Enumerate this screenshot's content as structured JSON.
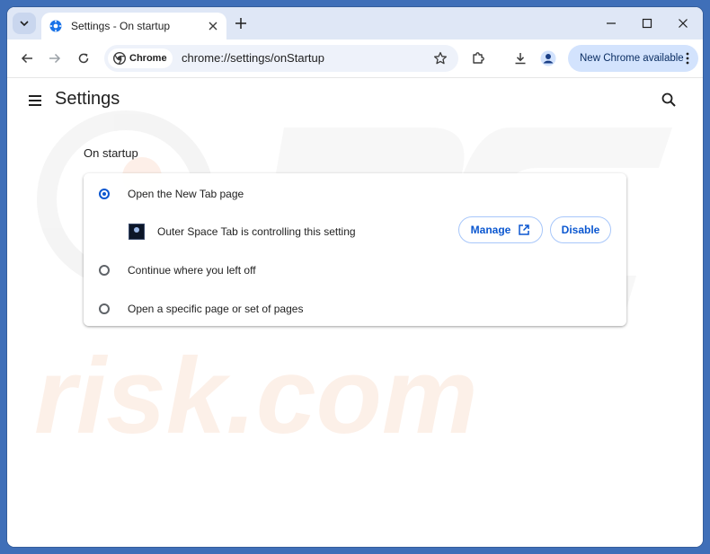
{
  "browser": {
    "tab_title": "Settings - On startup",
    "chip_label": "Chrome",
    "url": "chrome://settings/onStartup",
    "update_label": "New Chrome available"
  },
  "settings": {
    "page_title": "Settings",
    "section_title": "On startup",
    "options": [
      {
        "label": "Open the New Tab page",
        "selected": true
      },
      {
        "label": "Continue where you left off",
        "selected": false
      },
      {
        "label": "Open a specific page or set of pages",
        "selected": false
      }
    ],
    "extension": {
      "text": "Outer Space Tab is controlling this setting",
      "manage_label": "Manage",
      "disable_label": "Disable"
    }
  },
  "watermark": {
    "line1": "PC",
    "line2": "risk.com"
  },
  "colors": {
    "accent": "#0b57d0",
    "window_frame": "#3f6fb8",
    "tabstrip": "#dfe7f6",
    "update_button": "#d3e3fd"
  }
}
